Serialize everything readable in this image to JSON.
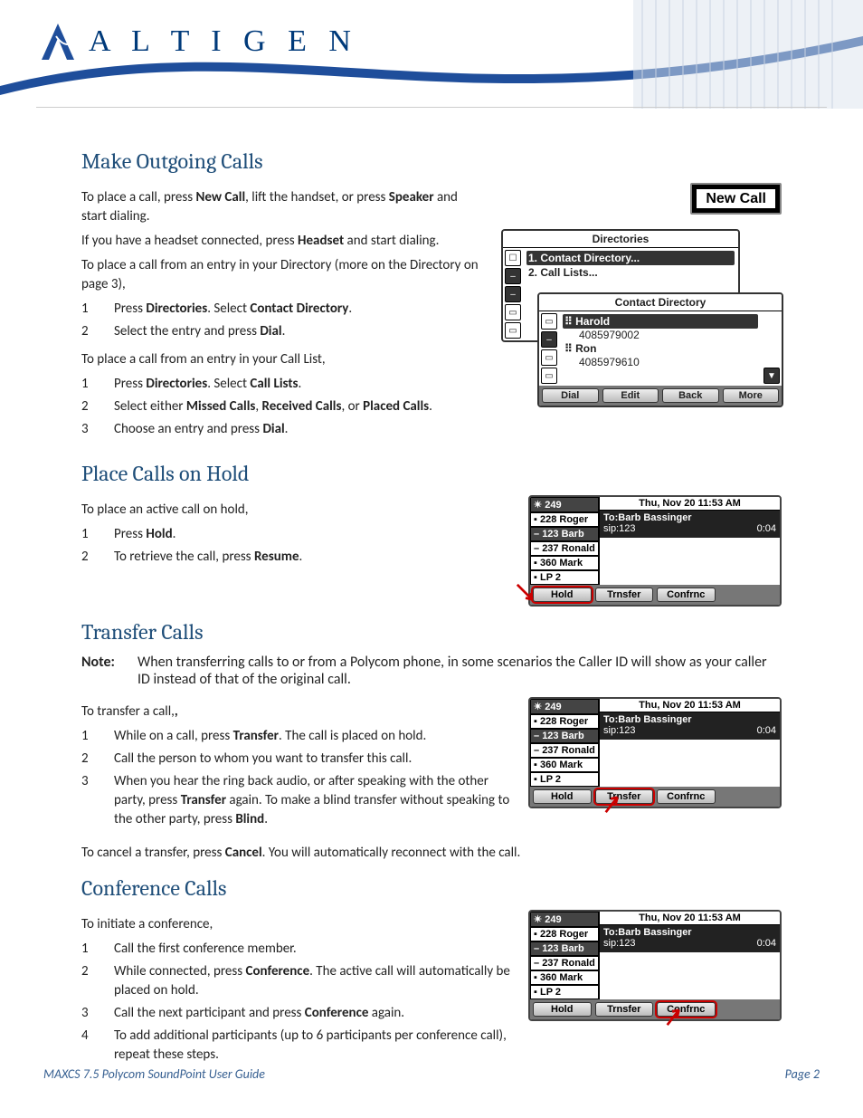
{
  "brand": "A L T I G E N",
  "footer": {
    "left": "MAXCS 7.5 Polycom SoundPoint User Guide",
    "right": "Page 2"
  },
  "new_call_button": "New Call",
  "make_calls": {
    "heading": "Make Outgoing Calls",
    "p1_a": "To place a call, press ",
    "p1_b": "New Call",
    "p1_c": ", lift the handset, or press ",
    "p1_d": "Speaker",
    "p1_e": " and start dialing.",
    "p2_a": "If you have a headset connected, press ",
    "p2_b": "Headset",
    "p2_c": " and start dialing.",
    "p3": "To place a call from an entry in your Directory (more on the Directory on page 3),",
    "list1": [
      {
        "n": "1",
        "a": "Press ",
        "b": "Directories",
        "c": ". Select ",
        "d": "Contact Directory",
        "e": "."
      },
      {
        "n": "2",
        "a": "Select the entry and press ",
        "b": "Dial",
        "c": "."
      }
    ],
    "p4": "To place a call from an entry in your Call List,",
    "list2": [
      {
        "n": "1",
        "a": "Press ",
        "b": "Directories",
        "c": ". Select ",
        "d": "Call Lists",
        "e": "."
      },
      {
        "n": "2",
        "a": "Select either ",
        "b": "Missed Calls",
        "c": ", ",
        "d": "Received Calls",
        "e": ", or ",
        "f": "Placed Calls",
        "g": "."
      },
      {
        "n": "3",
        "a": "Choose an entry and press ",
        "b": "Dial",
        "c": "."
      }
    ]
  },
  "directories_fig": {
    "title1": "Directories",
    "items1": [
      "1. Contact Directory...",
      "2. Call Lists..."
    ],
    "title2": "Contact Directory",
    "entries": [
      {
        "name": "Harold",
        "num": "4085979002"
      },
      {
        "name": "Ron",
        "num": "4085979610"
      }
    ],
    "keys": [
      "Dial",
      "Edit",
      "Back",
      "More"
    ]
  },
  "hold": {
    "heading": "Place Calls on Hold",
    "p1": "To place an active call on hold,",
    "list": [
      {
        "n": "1",
        "a": "Press ",
        "b": "Hold",
        "c": "."
      },
      {
        "n": "2",
        "a": "To retrieve the call, press ",
        "b": "Resume",
        "c": "."
      }
    ]
  },
  "call_screen": {
    "ext": "249",
    "time": "Thu, Nov 20   11:53 AM",
    "lines": [
      "228 Roger",
      "123 Barb",
      "237 Ronald",
      "360 Mark",
      "LP 2"
    ],
    "to": "To:Barb Bassinger",
    "sip": "sip:123",
    "dur": "0:04",
    "keys": [
      "Hold",
      "Trnsfer",
      "Confrnc"
    ]
  },
  "transfer": {
    "heading": "Transfer Calls",
    "note_label": "Note:",
    "note": "When transferring calls to or from a Polycom phone, in some scenarios the Caller ID will show as your caller ID instead of that of the original call.",
    "p1": "To transfer a call,",
    "list": [
      {
        "n": "1",
        "a": "While on a call, press ",
        "b": "Transfer",
        "c": ". The call is placed on hold."
      },
      {
        "n": "2",
        "a": "Call the person to whom you want to transfer this call."
      },
      {
        "n": "3",
        "a": "When you hear the ring back audio, or after speaking with the other party, press ",
        "b": "Transfer",
        "c": " again.  To make a blind transfer without speaking to the other party, press ",
        "d": "Blind",
        "e": "."
      }
    ],
    "p2_a": "To cancel a transfer, press ",
    "p2_b": "Cancel",
    "p2_c": ". You will automatically reconnect with the call."
  },
  "conference": {
    "heading": "Conference Calls",
    "p1": "To initiate a conference,",
    "list": [
      {
        "n": "1",
        "a": "Call the first conference member."
      },
      {
        "n": "2",
        "a": "While connected, press ",
        "b": "Conference",
        "c": ". The active call will automatically be placed on hold."
      },
      {
        "n": "3",
        "a": " Call the next participant and press ",
        "b": "Conference",
        "c": " again."
      },
      {
        "n": "4",
        "a": "To add additional participants (up to 6 participants per conference call), repeat these steps."
      }
    ]
  }
}
